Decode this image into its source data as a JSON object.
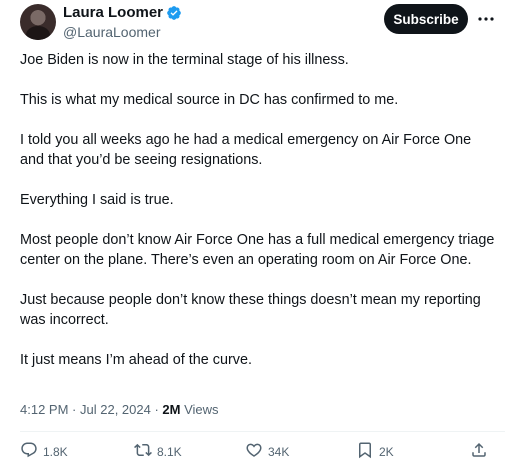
{
  "author": {
    "name": "Laura Loomer",
    "handle": "@LauraLoomer"
  },
  "header": {
    "subscribe_label": "Subscribe"
  },
  "post": {
    "paragraphs": [
      "Joe Biden is now in the terminal stage of his illness.",
      "This is what my medical source in DC has confirmed to me.",
      "I told you all weeks ago he had a medical emergency on Air Force One and that you’d be seeing resignations.",
      "Everything I said is true.",
      "Most people don’t know Air Force One has a full medical emergency triage center on the plane. There’s even an operating room on Air Force One.",
      "Just because people don’t know these things doesn’t mean my reporting was incorrect.",
      "It just means I’m ahead of the curve."
    ],
    "time": "4:12 PM",
    "date": "Jul 22, 2024",
    "views_count": "2M",
    "views_label": "Views"
  },
  "actions": {
    "replies": "1.8K",
    "reposts": "8.1K",
    "likes": "34K",
    "bookmarks": "2K"
  },
  "colors": {
    "verified": "#1d9bf0",
    "text_primary": "#0f1419",
    "text_secondary": "#536471",
    "button_bg": "#0f1419"
  },
  "icons": {
    "verified": "verified-badge-icon",
    "more": "more-horizontal-icon",
    "reply": "reply-icon",
    "repost": "repost-icon",
    "like": "heart-icon",
    "bookmark": "bookmark-icon",
    "share": "share-icon"
  }
}
